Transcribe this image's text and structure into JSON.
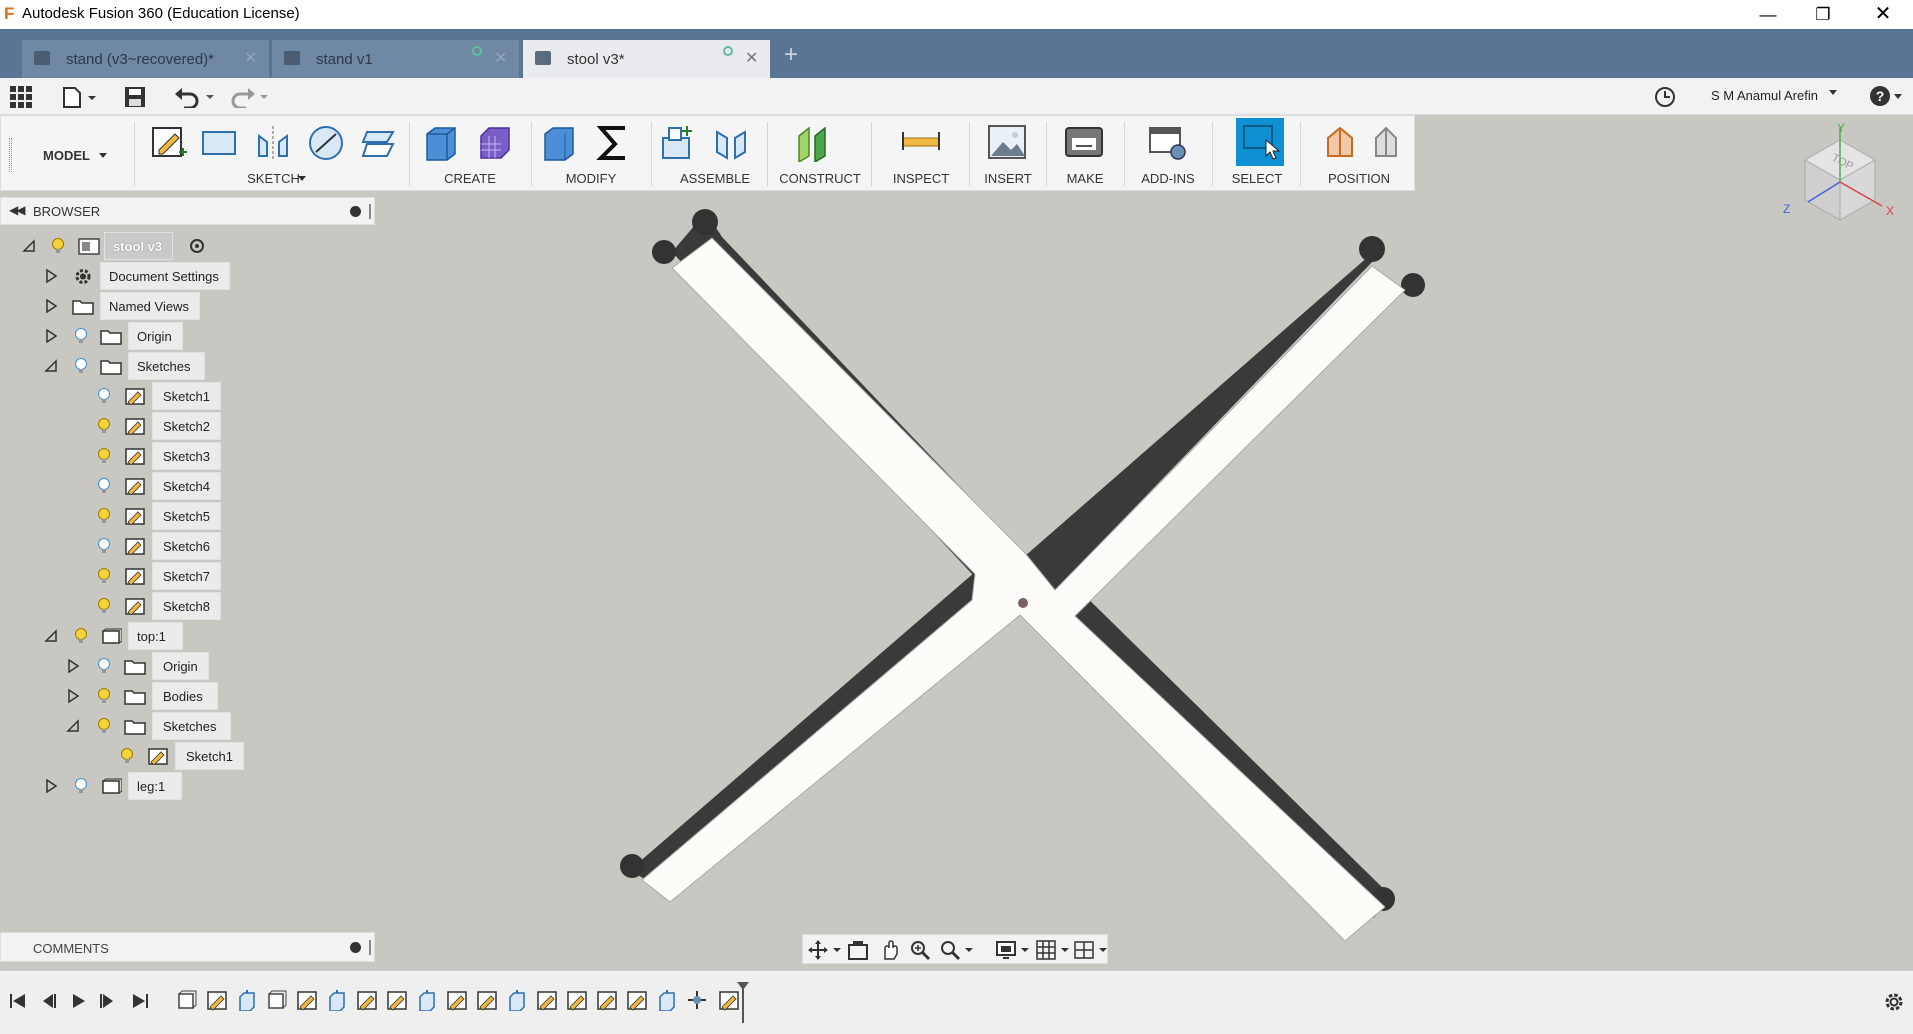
{
  "window": {
    "title": "Autodesk Fusion 360 (Education License)",
    "app_icon": "fusion-logo-icon"
  },
  "tabs": [
    {
      "label": "stand (v3~recovered)*",
      "active": false
    },
    {
      "label": "stand v1",
      "active": false
    },
    {
      "label": "stool v3*",
      "active": true
    }
  ],
  "toolbar": {
    "user": "S M Anamul Arefin",
    "help": "?"
  },
  "ribbon": {
    "workspace": "MODEL",
    "groups": [
      "SKETCH",
      "CREATE",
      "MODIFY",
      "ASSEMBLE",
      "CONSTRUCT",
      "INSPECT",
      "INSERT",
      "MAKE",
      "ADD-INS",
      "SELECT",
      "POSITION"
    ]
  },
  "browser": {
    "title": "BROWSER",
    "root": "stool v3",
    "items": [
      {
        "label": "Document Settings",
        "icon": "gear-icon"
      },
      {
        "label": "Named Views",
        "icon": "folder-icon"
      },
      {
        "label": "Origin",
        "icon": "folder-icon"
      },
      {
        "label": "Sketches",
        "icon": "folder-icon"
      },
      {
        "label": "Sketch1"
      },
      {
        "label": "Sketch2"
      },
      {
        "label": "Sketch3"
      },
      {
        "label": "Sketch4"
      },
      {
        "label": "Sketch5"
      },
      {
        "label": "Sketch6"
      },
      {
        "label": "Sketch7"
      },
      {
        "label": "Sketch8"
      },
      {
        "label": "top:1",
        "icon": "component-icon"
      },
      {
        "label": "Origin",
        "icon": "folder-icon"
      },
      {
        "label": "Bodies",
        "icon": "folder-icon"
      },
      {
        "label": "Sketches",
        "icon": "folder-icon"
      },
      {
        "label": "Sketch1"
      },
      {
        "label": "leg:1",
        "icon": "component-icon"
      }
    ]
  },
  "comments": {
    "title": "COMMENTS"
  },
  "viewcube": {
    "face": "TOP",
    "axes": {
      "x": "X",
      "y": "Y",
      "z": "Z"
    }
  },
  "colors": {
    "tabbar": "#5a7593",
    "select_active": "#0e90d2",
    "viewport": "#c9c7c2"
  }
}
